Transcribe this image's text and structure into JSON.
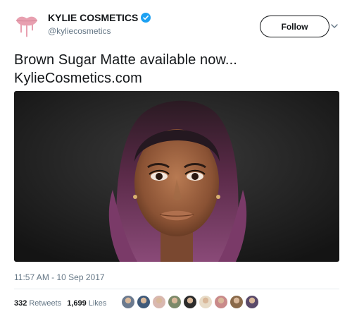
{
  "account": {
    "display_name": "KYLIE COSMETICS",
    "handle": "@kyliecosmetics",
    "verified": true,
    "avatar_icon": "lip-drip-logo",
    "brand_color": "#e8a0b0"
  },
  "actions": {
    "follow_label": "Follow",
    "more_icon": "chevron-down-icon"
  },
  "tweet": {
    "text_line_1": "Brown Sugar Matte available now...",
    "text_line_2": "KylieCosmetics.com",
    "timestamp": "11:57 AM - 10 Sep 2017"
  },
  "stats": {
    "retweets_count": "332",
    "retweets_label": "Retweets",
    "likes_count": "1,699",
    "likes_label": "Likes"
  },
  "liker_colors": [
    "#6b7a8f",
    "#3f5a7a",
    "#d9b8b0",
    "#7c8a6a",
    "#2b2b2b",
    "#e8dcc8",
    "#c98a8a",
    "#8a6a4a",
    "#5a4a6a"
  ],
  "colors": {
    "verified_blue": "#1da1f2",
    "text_secondary": "#657786"
  }
}
